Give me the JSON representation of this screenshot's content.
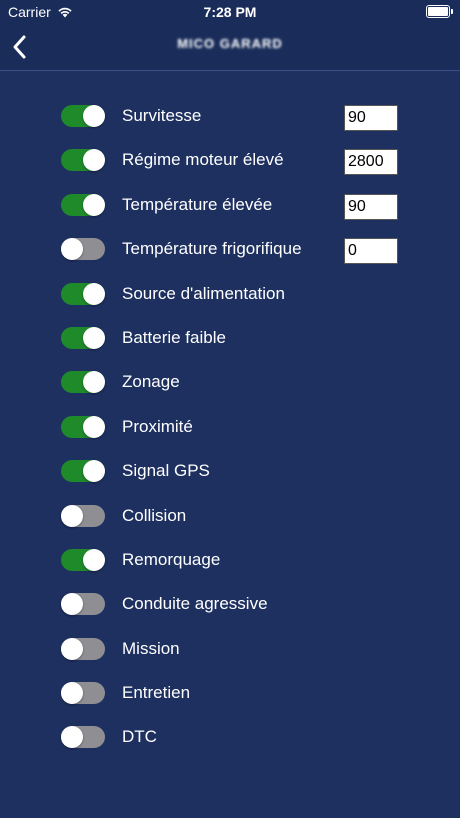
{
  "status_bar": {
    "carrier": "Carrier",
    "time": "7:28 PM",
    "icons": [
      "wifi-icon",
      "battery-icon"
    ]
  },
  "nav": {
    "title": "MICO GARARD",
    "back_icon": "chevron-left-icon"
  },
  "colors": {
    "background": "#1e3060",
    "toggle_on": "#1f8a2a",
    "toggle_off": "#8e8e93"
  },
  "alerts": [
    {
      "label": "Survitesse",
      "on": true,
      "value": "90"
    },
    {
      "label": "Régime moteur élevé",
      "on": true,
      "value": "2800"
    },
    {
      "label": "Température élevée",
      "on": true,
      "value": "90"
    },
    {
      "label": "Température frigorifique",
      "on": false,
      "value": "0"
    },
    {
      "label": "Source d'alimentation",
      "on": true
    },
    {
      "label": "Batterie faible",
      "on": true
    },
    {
      "label": "Zonage",
      "on": true
    },
    {
      "label": "Proximité",
      "on": true
    },
    {
      "label": "Signal GPS",
      "on": true
    },
    {
      "label": "Collision",
      "on": false
    },
    {
      "label": "Remorquage",
      "on": true
    },
    {
      "label": "Conduite agressive",
      "on": false
    },
    {
      "label": "Mission",
      "on": false
    },
    {
      "label": "Entretien",
      "on": false
    },
    {
      "label": "DTC",
      "on": false
    }
  ]
}
